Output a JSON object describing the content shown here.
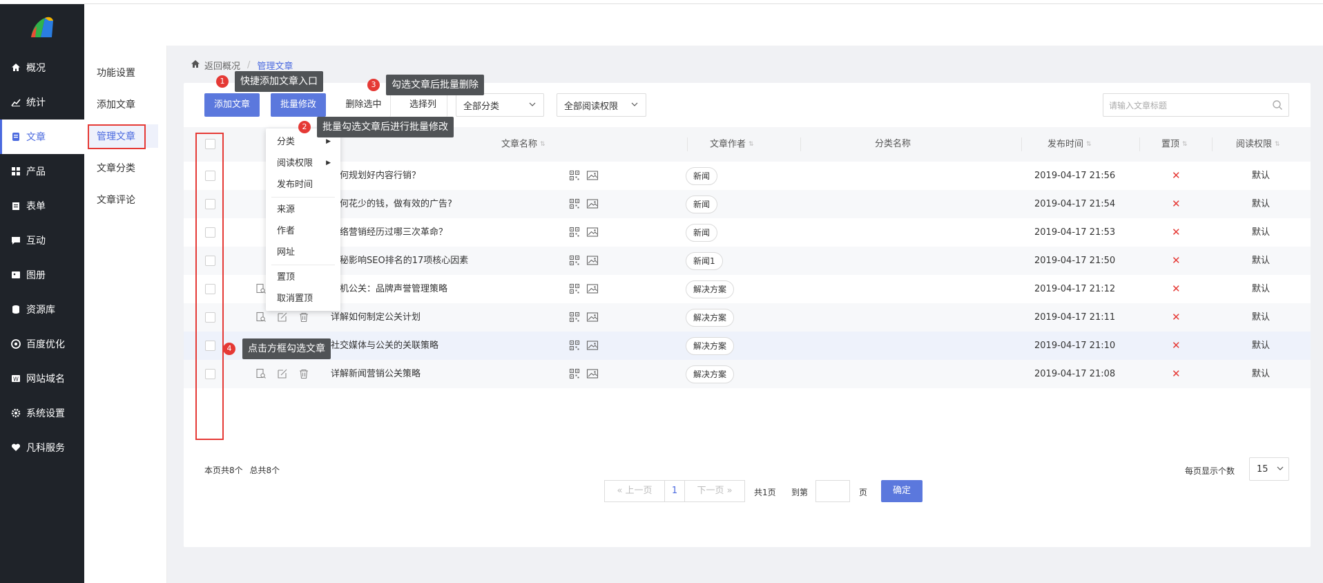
{
  "nav": {
    "items": [
      {
        "label": "概况",
        "icon": "home-icon"
      },
      {
        "label": "统计",
        "icon": "chart-icon"
      },
      {
        "label": "文章",
        "icon": "article-icon"
      },
      {
        "label": "产品",
        "icon": "grid-icon"
      },
      {
        "label": "表单",
        "icon": "form-icon"
      },
      {
        "label": "互动",
        "icon": "chat-icon"
      },
      {
        "label": "图册",
        "icon": "image-icon"
      },
      {
        "label": "资源库",
        "icon": "database-icon"
      },
      {
        "label": "百度优化",
        "icon": "baidu-icon"
      },
      {
        "label": "网站域名",
        "icon": "domain-icon"
      },
      {
        "label": "系统设置",
        "icon": "gear-icon"
      },
      {
        "label": "凡科服务",
        "icon": "heart-icon"
      }
    ],
    "active_index": 2
  },
  "subnav": {
    "items": [
      "功能设置",
      "添加文章",
      "管理文章",
      "文章分类",
      "文章评论"
    ]
  },
  "breadcrumb": {
    "back": "返回概况",
    "sep": "/",
    "current": "管理文章"
  },
  "toolbar": {
    "add_label": "添加文章",
    "batch_label": "批量修改",
    "delete_label": "删除选中",
    "columns_label": "选择列",
    "category_select": "全部分类",
    "permission_select": "全部阅读权限",
    "search_placeholder": "请输入文章标题"
  },
  "table": {
    "headers": {
      "title": "文章名称",
      "author": "文章作者",
      "category": "分类名称",
      "date": "发布时间",
      "top": "置顶",
      "permission": "阅读权限"
    },
    "rows": [
      {
        "title": "如何规划好内容行销？",
        "category": "新闻",
        "date": "2019-04-17 21:56",
        "top": "✕",
        "permission": "默认"
      },
      {
        "title": "如何花少的钱，做有效的广告?",
        "category": "新闻",
        "date": "2019-04-17 21:54",
        "top": "✕",
        "permission": "默认"
      },
      {
        "title": "网络营销经历过哪三次革命？",
        "category": "新闻",
        "date": "2019-04-17 21:53",
        "top": "✕",
        "permission": "默认"
      },
      {
        "title": "揭秘影响SEO排名的17项核心因素",
        "category": "新闻1",
        "date": "2019-04-17 21:50",
        "top": "✕",
        "permission": "默认"
      },
      {
        "title": "危机公关：品牌声誉管理策略",
        "category": "解决方案",
        "date": "2019-04-17 21:12",
        "top": "✕",
        "permission": "默认"
      },
      {
        "title": "详解如何制定公关计划",
        "category": "解决方案",
        "date": "2019-04-17 21:11",
        "top": "✕",
        "permission": "默认"
      },
      {
        "title": "社交媒体与公关的关联策略",
        "category": "解决方案",
        "date": "2019-04-17 21:10",
        "top": "✕",
        "permission": "默认"
      },
      {
        "title": "详解新闻营销公关策略",
        "category": "解决方案",
        "date": "2019-04-17 21:08",
        "top": "✕",
        "permission": "默认"
      }
    ]
  },
  "dropdown": {
    "items": [
      "分类",
      "阅读权限",
      "发布时间",
      "来源",
      "作者",
      "网址",
      "置顶",
      "取消置顶"
    ]
  },
  "callouts": [
    {
      "num": "1",
      "text": "快捷添加文章入口"
    },
    {
      "num": "2",
      "text": "批量勾选文章后进行批量修改"
    },
    {
      "num": "3",
      "text": "勾选文章后批量删除"
    },
    {
      "num": "4",
      "text": "点击方框勾选文章"
    }
  ],
  "footer": {
    "count_text": "本页共8个",
    "total_text": "总共8个",
    "prev": "上一页",
    "page": "1",
    "next": "下一页",
    "total_pages": "共1页",
    "goto": "到第",
    "page_unit": "页",
    "confirm": "确定",
    "per_page_label": "每页显示个数",
    "per_page_value": "15"
  },
  "colors": {
    "accent": "#5b78dd",
    "nav_bg": "#1f2329",
    "red": "#e53935"
  }
}
